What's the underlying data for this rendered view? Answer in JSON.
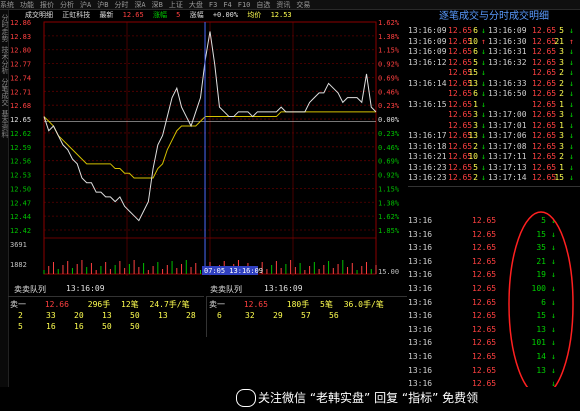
{
  "topbar": {
    "items": [
      "系统",
      "功能",
      "报价",
      "分析",
      "沪A",
      "沪B",
      "分时",
      "深A",
      "深B",
      "上证",
      "大盘",
      "F3",
      "F4",
      "F10",
      "自选",
      "资讯",
      "交易"
    ]
  },
  "sidetabs": [
    "分时走势",
    "技术分析",
    "分笔成交",
    "基本资料"
  ],
  "header": {
    "title": "成交明细",
    "stock": "正虹科技",
    "tag": "最新",
    "price": "12.65",
    "change_label": "涨幅",
    "change": "5",
    "pct_label": "涨幅",
    "pct": "+0.00%",
    "avg_label": "均价",
    "avg": "12.53"
  },
  "chart_data": {
    "type": "line",
    "title": "",
    "y_ticks_left": [
      "12.86",
      "12.83",
      "12.80",
      "12.77",
      "12.74",
      "12.71",
      "12.68",
      "12.65",
      "12.62",
      "12.59",
      "12.56",
      "12.53",
      "12.50",
      "12.47",
      "12.44",
      "12.42"
    ],
    "y_ticks_right": [
      "1.62%",
      "1.38%",
      "1.15%",
      "0.92%",
      "0.69%",
      "0.46%",
      "0.23%",
      "0.00%",
      "0.23%",
      "0.46%",
      "0.69%",
      "0.92%",
      "1.15%",
      "1.38%",
      "1.62%",
      "1.85%"
    ],
    "ylim": [
      12.42,
      12.86
    ],
    "baseline": 12.65,
    "price": [
      12.66,
      12.63,
      12.64,
      12.62,
      12.6,
      12.59,
      12.57,
      12.56,
      12.53,
      12.52,
      12.52,
      12.5,
      12.5,
      12.49,
      12.49,
      12.48,
      12.49,
      12.47,
      12.46,
      12.45,
      12.44,
      12.46,
      12.48,
      12.55,
      12.6,
      12.62,
      12.66,
      12.7,
      12.72,
      12.68,
      12.66,
      12.64,
      12.67,
      12.7,
      12.78,
      12.84,
      12.77,
      12.68,
      12.67,
      12.66,
      12.66,
      12.67,
      12.67,
      12.67,
      12.66,
      12.67,
      12.67,
      12.67,
      12.67,
      12.67,
      12.68,
      12.67,
      12.67,
      12.67,
      12.67,
      12.67,
      12.69,
      12.7,
      12.71,
      12.71,
      12.73,
      12.72,
      12.71,
      12.69,
      12.7,
      12.7,
      12.7,
      12.69,
      12.75,
      12.68,
      12.67
    ],
    "avg": [
      12.66,
      12.65,
      12.64,
      12.62,
      12.61,
      12.6,
      12.59,
      12.58,
      12.57,
      12.56,
      12.56,
      12.56,
      12.56,
      12.56,
      12.56,
      12.55,
      12.55,
      12.54,
      12.54,
      12.53,
      12.53,
      12.53,
      12.53,
      12.53,
      12.55,
      12.56,
      12.59,
      12.61,
      12.63,
      12.64,
      12.64,
      12.64,
      12.64,
      12.65,
      12.66,
      12.66,
      12.66,
      12.66,
      12.66,
      12.66,
      12.66,
      12.66,
      12.66,
      12.66,
      12.66,
      12.66,
      12.66,
      12.66,
      12.66,
      12.66,
      12.67,
      12.67,
      12.67,
      12.67,
      12.67,
      12.67,
      12.67,
      12.67,
      12.67,
      12.67,
      12.67,
      12.67,
      12.67,
      12.67,
      12.67,
      12.67,
      12.67,
      12.67,
      12.67,
      12.67,
      12.67
    ],
    "volume_ticks": [
      "3691",
      "1882"
    ],
    "time_label": "07:05 13:16:09",
    "vol_axis_right": "15.00"
  },
  "bottom_left": {
    "title": "卖卖队列",
    "time": "13:16:09",
    "level": "卖一",
    "price": "12.66",
    "qty": "296手",
    "orders": "12笔",
    "avg": "24.7手/笔",
    "queue": [
      "2",
      "33",
      "20",
      "13",
      "50",
      "13",
      "28",
      "5",
      "16",
      "16",
      "50",
      "50"
    ]
  },
  "bottom_right": {
    "title": "卖卖队列",
    "time": "13:16:09",
    "level": "卖一",
    "price": "12.65",
    "qty": "180手",
    "orders": "5笔",
    "avg": "36.0手/笔",
    "queue": [
      "6",
      "32",
      "29",
      "57",
      "56"
    ]
  },
  "right_panel": {
    "title": "逐笔成交与分时成交明细",
    "rows_a": [
      [
        "13:16:09",
        "12.65",
        "6",
        "↓",
        "13:16:09",
        "12.65",
        "5",
        "↓"
      ],
      [
        "13:16:09",
        "12.65",
        "10",
        "↑",
        "13:16:30",
        "12.65",
        "21",
        "↑"
      ],
      [
        "13:16:09",
        "12.65",
        "6",
        "↓",
        "13:16:31",
        "12.65",
        "3",
        "↓"
      ],
      [
        "13:16:12",
        "12.65",
        "5",
        "↓",
        "13:16:32",
        "12.65",
        "3",
        "↓"
      ],
      [
        "",
        "12.65",
        "15",
        "↓",
        "",
        "12.65",
        "2",
        "↓"
      ],
      [
        "13:16:14",
        "12.65",
        "13",
        "↓",
        "13:16:33",
        "12.65",
        "2",
        "↓"
      ],
      [
        "",
        "12.65",
        "6",
        "↓",
        "13:16:50",
        "12.65",
        "2",
        "↓"
      ],
      [
        "13:16:15",
        "12.65",
        "1",
        "↓",
        "",
        "12.65",
        "1",
        "↓"
      ],
      [
        "",
        "12.65",
        "3",
        "↓",
        "13:17:00",
        "12.65",
        "3",
        "↓"
      ],
      [
        "",
        "12.65",
        "3",
        "↓",
        "13:17:01",
        "12.65",
        "1",
        "↓"
      ],
      [
        "13:16:17",
        "12.65",
        "13",
        "↓",
        "13:17:06",
        "12.65",
        "3",
        "↓"
      ],
      [
        "13:16:18",
        "12.65",
        "2",
        "↓",
        "13:17:08",
        "12.65",
        "3",
        "↓"
      ],
      [
        "13:16:21",
        "12.65",
        "10",
        "↓",
        "13:17:11",
        "12.65",
        "2",
        "↓"
      ],
      [
        "13:16:23",
        "12.65",
        "5",
        "↓",
        "13:17:13",
        "12.65",
        "1",
        "↓"
      ],
      [
        "13:16:23",
        "12.65",
        "2",
        "↓",
        "13:17:14",
        "12.65",
        "15",
        "↓"
      ]
    ],
    "rows_b": [
      [
        "13:16",
        "12.65",
        "5",
        "↓"
      ],
      [
        "13:16",
        "12.65",
        "15",
        "↓"
      ],
      [
        "13:16",
        "12.65",
        "35",
        "↓"
      ],
      [
        "13:16",
        "12.65",
        "21",
        "↓"
      ],
      [
        "13:16",
        "12.65",
        "19",
        "↓"
      ],
      [
        "13:16",
        "12.65",
        "100",
        "↓"
      ],
      [
        "13:16",
        "12.65",
        "6",
        "↓"
      ],
      [
        "13:16",
        "12.65",
        "15",
        "↓"
      ],
      [
        "13:16",
        "12.65",
        "13",
        "↓"
      ],
      [
        "13:16",
        "12.65",
        "101",
        "↓"
      ],
      [
        "13:16",
        "12.65",
        "14",
        "↓"
      ],
      [
        "13:16",
        "12.65",
        "13",
        "↓"
      ],
      [
        "13:16",
        "12.65",
        "",
        "↓"
      ]
    ]
  },
  "watermark": {
    "text": "关注微信 “老韩实盘” 回复 “指标” 免费领"
  },
  "colors": {
    "price_line": "#e0e0e0",
    "avg_line": "#d4c000",
    "grid": "#8b0000",
    "up": "#ff4040",
    "down": "#00d000",
    "marker": "#4a6bff"
  }
}
